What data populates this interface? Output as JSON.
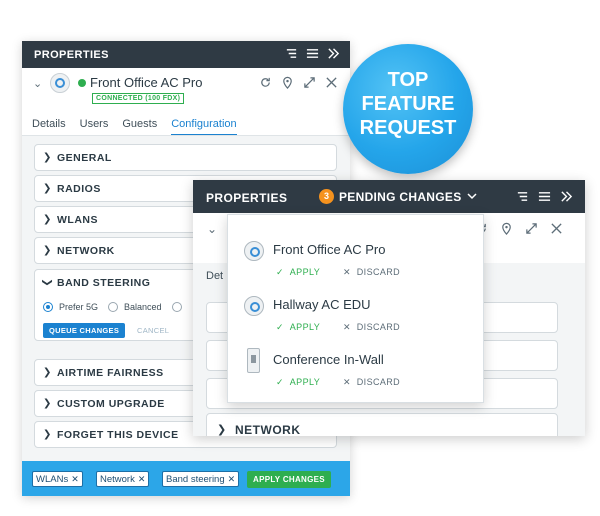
{
  "back_panel": {
    "title": "PROPERTIES",
    "device_name": "Front Office AC Pro",
    "status": "CONNECTED (100 FDX)",
    "tabs": [
      {
        "label": "Details"
      },
      {
        "label": "Users"
      },
      {
        "label": "Guests"
      },
      {
        "label": "Configuration",
        "active": true
      }
    ],
    "sections": [
      "GENERAL",
      "RADIOS",
      "WLANS",
      "NETWORK",
      "BAND STEERING",
      "AIRTIME FAIRNESS",
      "CUSTOM UPGRADE",
      "FORGET THIS DEVICE"
    ],
    "band_steering": {
      "options": [
        "Prefer 5G",
        "Balanced"
      ],
      "selected": "Prefer 5G",
      "queue_label": "QUEUE CHANGES",
      "cancel_label": "CANCEL"
    },
    "footer": {
      "chips": [
        "WLANs",
        "Network",
        "Band steering"
      ],
      "apply_label": "APPLY CHANGES"
    }
  },
  "badge": {
    "lines": [
      "TOP",
      "FEATURE",
      "REQUEST"
    ],
    "color": "#24a5ea"
  },
  "front_panel": {
    "title": "PROPERTIES",
    "pending_count": "3",
    "pending_label": "PENDING CHANGES",
    "details_partial": "Det",
    "sections": [
      "NETWORK"
    ]
  },
  "pending_dropdown": {
    "items": [
      {
        "name": "Front Office AC Pro",
        "icon": "access-point-icon"
      },
      {
        "name": "Hallway AC EDU",
        "icon": "access-point-icon"
      },
      {
        "name": "Conference In-Wall",
        "icon": "in-wall-ap-icon"
      }
    ],
    "apply_label": "APPLY",
    "discard_label": "DISCARD"
  },
  "colors": {
    "header": "#2f3a44",
    "accent": "#1b82d0",
    "success": "#2eae4f",
    "footer": "#2ca6e8",
    "pending": "#f5921e"
  }
}
